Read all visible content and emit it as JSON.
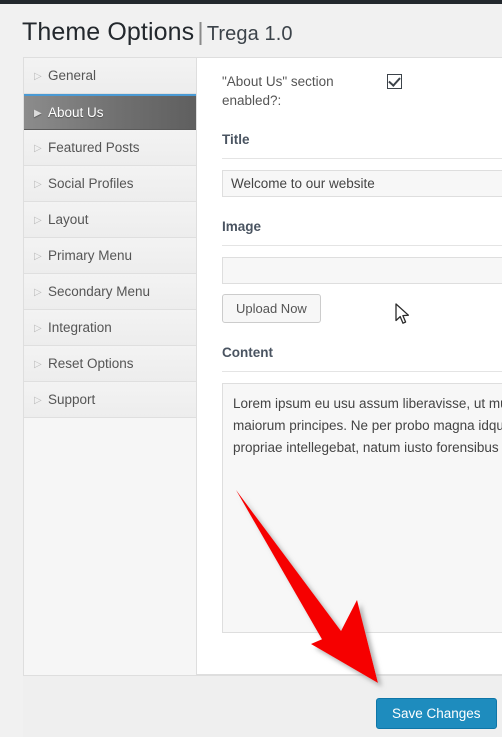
{
  "header": {
    "title": "Theme Options",
    "separator": "|",
    "version": "Trega 1.0"
  },
  "sidebar": {
    "items": [
      {
        "label": "General",
        "marker": "▷",
        "active": false
      },
      {
        "label": "About Us",
        "marker": "▶",
        "active": true
      },
      {
        "label": "Featured Posts",
        "marker": "▷",
        "active": false
      },
      {
        "label": "Social Profiles",
        "marker": "▷",
        "active": false
      },
      {
        "label": "Layout",
        "marker": "▷",
        "active": false
      },
      {
        "label": "Primary Menu",
        "marker": "▷",
        "active": false
      },
      {
        "label": "Secondary Menu",
        "marker": "▷",
        "active": false
      },
      {
        "label": "Integration",
        "marker": "▷",
        "active": false
      },
      {
        "label": "Reset Options",
        "marker": "▷",
        "active": false
      },
      {
        "label": "Support",
        "marker": "▷",
        "active": false
      }
    ]
  },
  "form": {
    "enabled_label_line1": "\"About Us\" section",
    "enabled_label_line2": "enabled?:",
    "enabled_checked": true,
    "title_label": "Title",
    "title_value": "Welcome to our website",
    "image_label": "Image",
    "image_value": "",
    "upload_button": "Upload Now",
    "content_label": "Content",
    "content_lines": [
      "Lorem ipsum eu usu assum liberavisse, ut mun",
      "maiorum principes. Ne per probo magna idque",
      "propriae intellegebat, natum iusto forensibus d"
    ]
  },
  "footer": {
    "save_label": "Save Changes"
  },
  "annotation": {
    "arrow_color": "#f60000",
    "arrow_from": "235,490",
    "arrow_to": "377,682"
  },
  "colors": {
    "admin_bar": "#23282d",
    "primary_button": "#1e8cbe",
    "active_nav_accent": "#4a9ad4"
  }
}
